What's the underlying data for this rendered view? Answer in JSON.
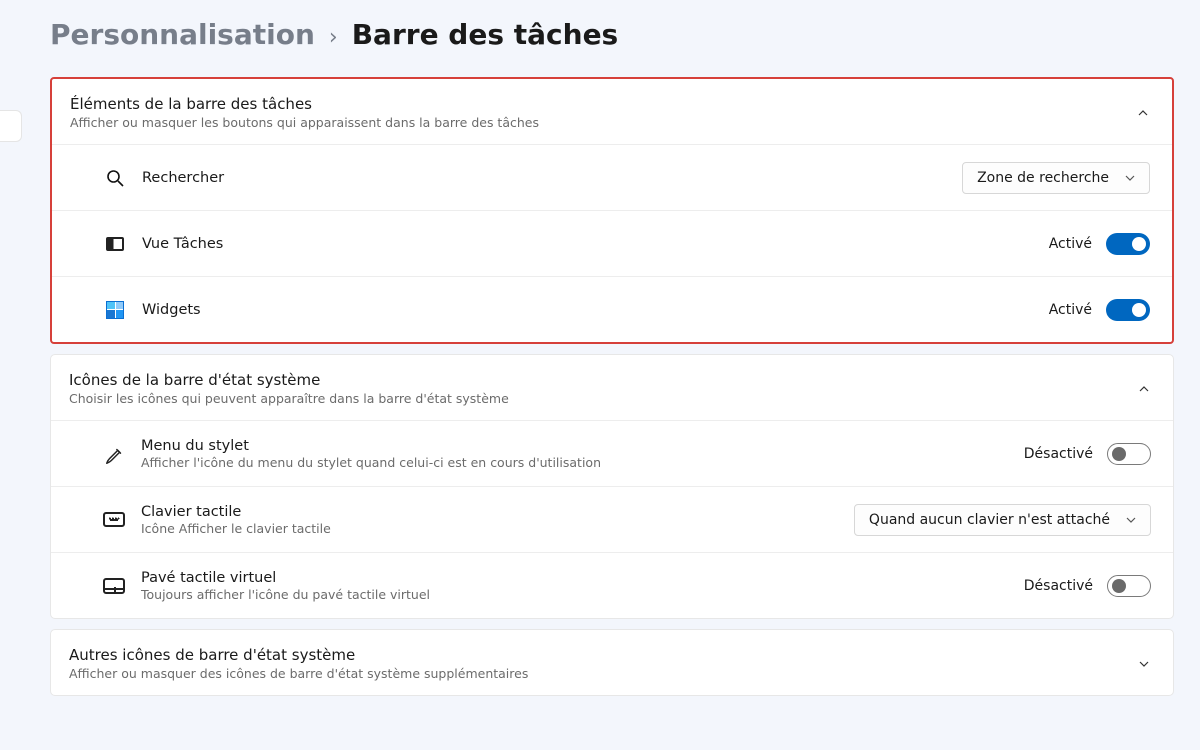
{
  "breadcrumb": {
    "parent": "Personnalisation",
    "separator": "›",
    "current": "Barre des tâches"
  },
  "sections": {
    "taskbar_items": {
      "title": "Éléments de la barre des tâches",
      "subtitle": "Afficher ou masquer les boutons qui apparaissent dans la barre des tâches",
      "expanded": true,
      "rows": {
        "search": {
          "label": "Rechercher",
          "dropdown_value": "Zone de recherche"
        },
        "taskview": {
          "label": "Vue Tâches",
          "state_label": "Activé",
          "state": "on"
        },
        "widgets": {
          "label": "Widgets",
          "state_label": "Activé",
          "state": "on"
        }
      }
    },
    "systray_icons": {
      "title": "Icônes de la barre d'état système",
      "subtitle": "Choisir les icônes qui peuvent apparaître dans la barre d'état système",
      "expanded": true,
      "rows": {
        "pen": {
          "label": "Menu du stylet",
          "sub": "Afficher l'icône du menu du stylet quand celui-ci est en cours d'utilisation",
          "state_label": "Désactivé",
          "state": "off"
        },
        "touch_keyboard": {
          "label": "Clavier tactile",
          "sub": "Icône Afficher le clavier tactile",
          "dropdown_value": "Quand aucun clavier n'est attaché"
        },
        "virtual_touchpad": {
          "label": "Pavé tactile virtuel",
          "sub": "Toujours afficher l'icône du pavé tactile virtuel",
          "state_label": "Désactivé",
          "state": "off"
        }
      }
    },
    "other_systray": {
      "title": "Autres icônes de barre d'état système",
      "subtitle": "Afficher ou masquer des icônes de barre d'état système supplémentaires",
      "expanded": false
    }
  }
}
